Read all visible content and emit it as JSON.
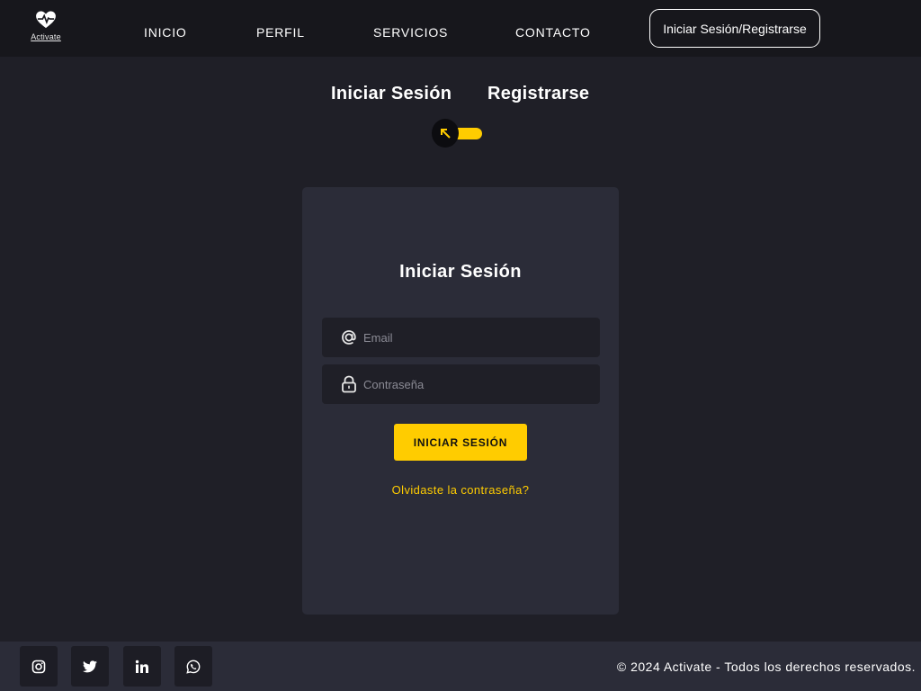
{
  "header": {
    "logo_text": "Activate",
    "nav": [
      {
        "label": "INICIO"
      },
      {
        "label": "PERFIL"
      },
      {
        "label": "SERVICIOS"
      },
      {
        "label": "CONTACTO"
      }
    ],
    "login_button": "Iniciar Sesión/Registrarse"
  },
  "switcher": {
    "login_label": "Iniciar Sesión",
    "register_label": "Registrarse",
    "toggle_icon": "arrow-up-left-icon",
    "active": "login"
  },
  "form": {
    "title": "Iniciar Sesión",
    "email": {
      "placeholder": "Email",
      "value": "",
      "icon": "at-icon"
    },
    "password": {
      "placeholder": "Contraseña",
      "value": "",
      "icon": "lock-icon"
    },
    "submit_label": "INICIAR SESIÓN",
    "forgot_label": "Olvidaste la contraseña?"
  },
  "footer": {
    "social": [
      {
        "icon": "instagram-icon"
      },
      {
        "icon": "twitter-icon"
      },
      {
        "icon": "linkedin-icon"
      },
      {
        "icon": "whatsapp-icon"
      }
    ],
    "copyright": "© 2024 Activate - Todos los derechos reservados."
  },
  "colors": {
    "accent": "#ffcc00",
    "background": "#1f1f27",
    "header": "#17171c",
    "card": "#2b2c38"
  }
}
